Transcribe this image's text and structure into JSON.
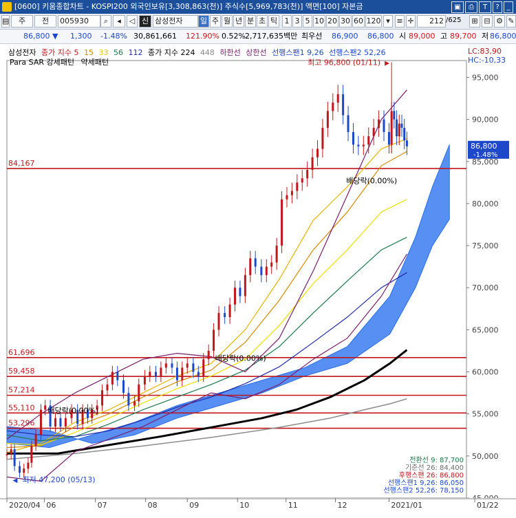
{
  "window": {
    "title": "[0600] 키움종합차트 - KOSPI200 외국인보유[3,308,863(천)] 주식수[5,969,783(천)] 액면[100] 자본금",
    "buttons": [
      "▣",
      "⎙",
      "T",
      "?",
      "_",
      "□",
      "×"
    ]
  },
  "toolbar": {
    "market": "주",
    "prev": "전",
    "code": "005930",
    "sin": "신",
    "name": "삼성전자",
    "periods": [
      "일",
      "주",
      "월",
      "년",
      "분",
      "초",
      "틱"
    ],
    "active_period": "일",
    "intervals": [
      "1",
      "3",
      "5",
      "10",
      "20",
      "30",
      "60",
      "120"
    ],
    "count": "212",
    "total": "/625"
  },
  "quote": {
    "price": "86,800",
    "direction": "▼",
    "change": "1,300",
    "change_pct": "-1.48%",
    "volume": "30,861,661",
    "vol_ratio": "121.90%",
    "turnover": "0.52%",
    "amount": "2,717,635백만",
    "priority": "최우선",
    "ask": "86,900",
    "bid": "86,800",
    "open_label": "시",
    "open": "89,000",
    "high_label": "고",
    "high": "89,700",
    "low_label": "저",
    "low": "86,800"
  },
  "legend": {
    "stock": "삼성전자",
    "ma_label": "종가 지수",
    "ma5": "5",
    "ma15": "15",
    "ma33": "33",
    "ma56": "56",
    "ma112": "112",
    "ma224_label": "종가 지수 224",
    "ma448": "448",
    "lower_band": "하한선",
    "upper_band": "상한선",
    "span1": "선행스팬1 9,26",
    "span2": "선행스팬2 52,26",
    "psar": "Para SAR 강세패턴",
    "psar_weak": "약세패턴",
    "lc": "LC:83,90",
    "hc": "HC:-10,33"
  },
  "annotations": {
    "high": "최고 96,800 (01/11)",
    "low": "최저 47,200 (05/13)",
    "dividend": "배당락(0.00%)",
    "last_price": "86,800",
    "last_pct": "-1.48%"
  },
  "levels": [
    {
      "label": "84,167",
      "value": 84167
    },
    {
      "label": "61,696",
      "value": 61696
    },
    {
      "label": "59,458",
      "value": 59458
    },
    {
      "label": "57,214",
      "value": 57214
    },
    {
      "label": "55,110",
      "value": 55110
    },
    {
      "label": "53,296",
      "value": 53296
    }
  ],
  "ichimoku_values": [
    {
      "text": "전환선 9: 87,700",
      "color": "#1a7a4a"
    },
    {
      "text": "기준선 26: 84,400",
      "color": "#6b6b6b"
    },
    {
      "text": "후행스팬 26: 86,800",
      "color": "#c0161c"
    },
    {
      "text": "선행스팬1 9,26: 86,050",
      "color": "#1d48c9"
    },
    {
      "text": "선행스팬2 52,26: 78,150",
      "color": "#1d48c9"
    }
  ],
  "chart_data": {
    "type": "line",
    "ylim": [
      45000,
      97000
    ],
    "yticks": [
      "95,000",
      "90,000",
      "85,000",
      "80,000",
      "75,000",
      "70,000",
      "65,000",
      "60,000",
      "55,000",
      "50,000",
      "45,000"
    ],
    "ytick_values": [
      95000,
      90000,
      85000,
      80000,
      75000,
      70000,
      65000,
      60000,
      55000,
      50000,
      45000
    ],
    "xticks": [
      "2020/04",
      "06",
      "07",
      "08",
      "09",
      "10",
      "11",
      "12",
      "2021/01",
      "01/22"
    ],
    "xtick_days": [
      0,
      44,
      104,
      163,
      212,
      271,
      328,
      386,
      449,
      512
    ],
    "series": [
      {
        "name": "삼성전자",
        "role": "close",
        "color": "#c0161c",
        "x": [
          0,
          5,
          9,
          15,
          20,
          25,
          29,
          34,
          40,
          45,
          51,
          57,
          63,
          69,
          76,
          83,
          89,
          95,
          100,
          106,
          112,
          118,
          124,
          130,
          137,
          143,
          150,
          155,
          162,
          168,
          175,
          181,
          187,
          194,
          200,
          206,
          212,
          219,
          225,
          231,
          237,
          243,
          249,
          256,
          262,
          268,
          274,
          280,
          286,
          292,
          299,
          305,
          311,
          317,
          323,
          329,
          335,
          341,
          347,
          353,
          359,
          365,
          371,
          377,
          383,
          389,
          395,
          401,
          407,
          413,
          419,
          425,
          431,
          437,
          443,
          449,
          452,
          455,
          458,
          461,
          464,
          467,
          470
        ],
        "values": [
          50200,
          50800,
          48800,
          48000,
          48500,
          49200,
          51200,
          52500,
          55500,
          56000,
          53500,
          54500,
          53500,
          54500,
          55500,
          53800,
          55500,
          54500,
          55500,
          56000,
          57800,
          58500,
          60000,
          59000,
          57500,
          56000,
          56500,
          58500,
          59500,
          60000,
          59500,
          60500,
          61000,
          60500,
          59000,
          60500,
          61000,
          60000,
          59500,
          61500,
          62500,
          65000,
          67000,
          66500,
          68000,
          70000,
          69000,
          71500,
          73500,
          72500,
          71500,
          72500,
          73000,
          75000,
          80500,
          81000,
          81500,
          82500,
          83000,
          84000,
          85500,
          86500,
          89000,
          91000,
          92000,
          93000,
          90500,
          88500,
          87000,
          86800,
          87000,
          88000,
          89000,
          90000,
          88500,
          87000,
          91000,
          90000,
          88000,
          89500,
          89000,
          87500,
          86800
        ]
      },
      {
        "name": "5",
        "color": "#e6b400",
        "x": [
          0,
          40,
          80,
          120,
          160,
          200,
          240,
          280,
          320,
          360,
          400,
          440,
          470
        ],
        "values": [
          50400,
          51500,
          54000,
          55500,
          57500,
          59500,
          61000,
          65000,
          71000,
          78000,
          82000,
          86500,
          87700
        ]
      },
      {
        "name": "15",
        "color": "#d98a00",
        "x": [
          0,
          40,
          80,
          120,
          160,
          200,
          240,
          280,
          320,
          360,
          400,
          440,
          470
        ],
        "values": [
          51000,
          51200,
          53500,
          55000,
          57000,
          58800,
          60200,
          63500,
          68500,
          74500,
          79000,
          84500,
          86200
        ]
      },
      {
        "name": "33",
        "color": "#f0e000",
        "x": [
          0,
          40,
          80,
          120,
          160,
          200,
          240,
          280,
          320,
          360,
          400,
          440,
          470
        ],
        "values": [
          51500,
          51300,
          52800,
          54500,
          56300,
          58000,
          59500,
          61500,
          65500,
          70500,
          74500,
          79000,
          80500
        ]
      },
      {
        "name": "56",
        "color": "#1a7a4a",
        "x": [
          0,
          40,
          80,
          120,
          160,
          200,
          240,
          280,
          320,
          360,
          400,
          440,
          470
        ],
        "values": [
          52500,
          51800,
          52300,
          53800,
          55500,
          57000,
          58500,
          60200,
          63000,
          67000,
          70800,
          74500,
          76000
        ]
      },
      {
        "name": "112",
        "color": "#1f2aa8",
        "x": [
          0,
          40,
          80,
          120,
          160,
          200,
          240,
          280,
          320,
          360,
          400,
          440,
          470
        ],
        "values": [
          53000,
          52500,
          52300,
          53000,
          54300,
          55800,
          57000,
          58600,
          60600,
          63500,
          66500,
          70000,
          71800
        ]
      },
      {
        "name": "224",
        "color": "#000000",
        "x": [
          0,
          60,
          120,
          180,
          240,
          300,
          340,
          380,
          420,
          450,
          470
        ],
        "values": [
          50300,
          50300,
          51300,
          52300,
          53400,
          54500,
          55500,
          57000,
          59000,
          61000,
          62600
        ]
      },
      {
        "name": "448",
        "color": "#8c8c8c",
        "x": [
          0,
          80,
          160,
          240,
          320,
          380,
          420,
          450,
          470
        ],
        "values": [
          49600,
          50300,
          51200,
          52200,
          53400,
          54500,
          55500,
          56200,
          56800
        ]
      },
      {
        "name": "상한선",
        "color": "#7a1d6e",
        "x": [
          0,
          40,
          80,
          120,
          160,
          200,
          240,
          280,
          320,
          360,
          400,
          440,
          470
        ],
        "values": [
          52000,
          55000,
          57500,
          59500,
          61500,
          62200,
          61800,
          60000,
          64000,
          72000,
          81000,
          90000,
          93500
        ]
      },
      {
        "name": "하한선",
        "color": "#7a1d6e",
        "x": [
          0,
          40,
          80,
          120,
          160,
          200,
          240,
          280,
          320,
          360,
          400,
          440,
          470
        ],
        "values": [
          47500,
          47000,
          50500,
          52000,
          53500,
          55500,
          57500,
          56800,
          58500,
          61500,
          64000,
          69000,
          74000
        ]
      },
      {
        "name": "선행스팬1 9,26",
        "color": "#2a6fe8",
        "x": [
          0,
          50,
          100,
          150,
          200,
          250,
          300,
          350,
          400,
          450,
          480,
          500,
          520
        ],
        "values": [
          51500,
          51000,
          52500,
          54000,
          56000,
          57500,
          59000,
          60500,
          63000,
          69000,
          76000,
          82000,
          87000
        ]
      },
      {
        "name": "선행스팬2 52,26",
        "color": "#2a6fe8",
        "x": [
          0,
          50,
          100,
          150,
          200,
          250,
          300,
          350,
          400,
          450,
          480,
          500,
          520
        ],
        "values": [
          53500,
          53000,
          51500,
          52500,
          54500,
          56000,
          57500,
          59500,
          61000,
          64500,
          70000,
          75000,
          78150
        ]
      }
    ]
  }
}
